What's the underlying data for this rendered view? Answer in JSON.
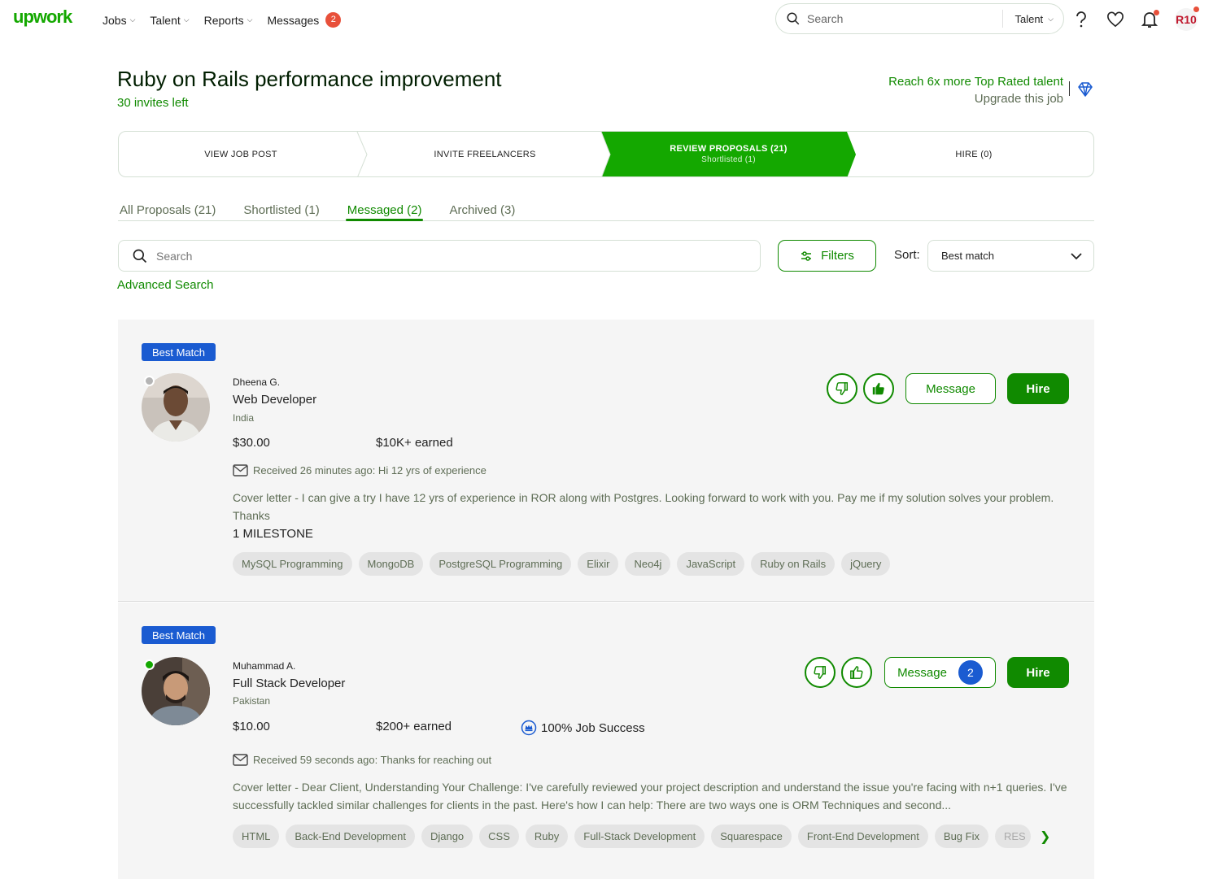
{
  "header": {
    "logo": "upwork",
    "nav": [
      {
        "label": "Jobs"
      },
      {
        "label": "Talent"
      },
      {
        "label": "Reports"
      },
      {
        "label": "Messages",
        "badge": "2"
      }
    ],
    "search_placeholder": "Search",
    "search_scope": "Talent",
    "avatar_initials": "R10"
  },
  "job": {
    "title": "Ruby on Rails performance improvement",
    "invites_left": "30 invites left",
    "upgrade_reach": "Reach 6x more Top Rated talent",
    "upgrade_link": "Upgrade this job"
  },
  "stepper": [
    {
      "label": "VIEW JOB POST"
    },
    {
      "label": "INVITE FREELANCERS"
    },
    {
      "label": "REVIEW PROPOSALS (21)",
      "sub": "Shortlisted (1)",
      "active": true
    },
    {
      "label": "HIRE (0)"
    }
  ],
  "tabs": [
    {
      "label": "All Proposals (21)"
    },
    {
      "label": "Shortlisted (1)"
    },
    {
      "label": "Messaged (2)",
      "active": true
    },
    {
      "label": "Archived (3)"
    }
  ],
  "search": {
    "placeholder": "Search"
  },
  "filters_label": "Filters",
  "sort": {
    "label": "Sort:",
    "value": "Best match"
  },
  "advanced_search": "Advanced Search",
  "colors": {
    "brand": "#108a00",
    "badge_blue": "#1a5bd1",
    "online": "#14a800",
    "offline": "#b5b5b5"
  },
  "proposals": [
    {
      "badge": "Best Match",
      "name": "Dheena G.",
      "title": "Web Developer",
      "country": "India",
      "rate": "$30.00",
      "earned": "$10K+ earned",
      "received": "Received 26 minutes ago: Hi 12 yrs of experience",
      "cover_letter": "Cover letter - I can give a try I have 12 yrs of experience in ROR along with Postgres. Looking forward to work with you. Pay me if my solution solves your problem. Thanks",
      "milestone": "1 MILESTONE",
      "message_label": "Message",
      "hire_label": "Hire",
      "online": false,
      "skills": [
        "MySQL Programming",
        "MongoDB",
        "PostgreSQL Programming",
        "Elixir",
        "Neo4j",
        "JavaScript",
        "Ruby on Rails",
        "jQuery"
      ]
    },
    {
      "badge": "Best Match",
      "name": "Muhammad A.",
      "title": "Full Stack Developer",
      "country": "Pakistan",
      "rate": "$10.00",
      "earned": "$200+ earned",
      "job_success": "100% Job Success",
      "received": "Received 59 seconds ago: Thanks for reaching out",
      "cover_letter": "Cover letter - Dear Client, Understanding Your Challenge: I've carefully reviewed your project description and understand the issue you're facing with n+1 queries. I've successfully tackled similar challenges for clients in the past. Here's how I can help: There are two ways one is ORM Techniques and second...",
      "message_label": "Message",
      "message_count": "2",
      "hire_label": "Hire",
      "online": true,
      "skills": [
        "HTML",
        "Back-End Development",
        "Django",
        "CSS",
        "Ruby",
        "Full-Stack Development",
        "Squarespace",
        "Front-End Development",
        "Bug Fix",
        "RES"
      ]
    }
  ]
}
